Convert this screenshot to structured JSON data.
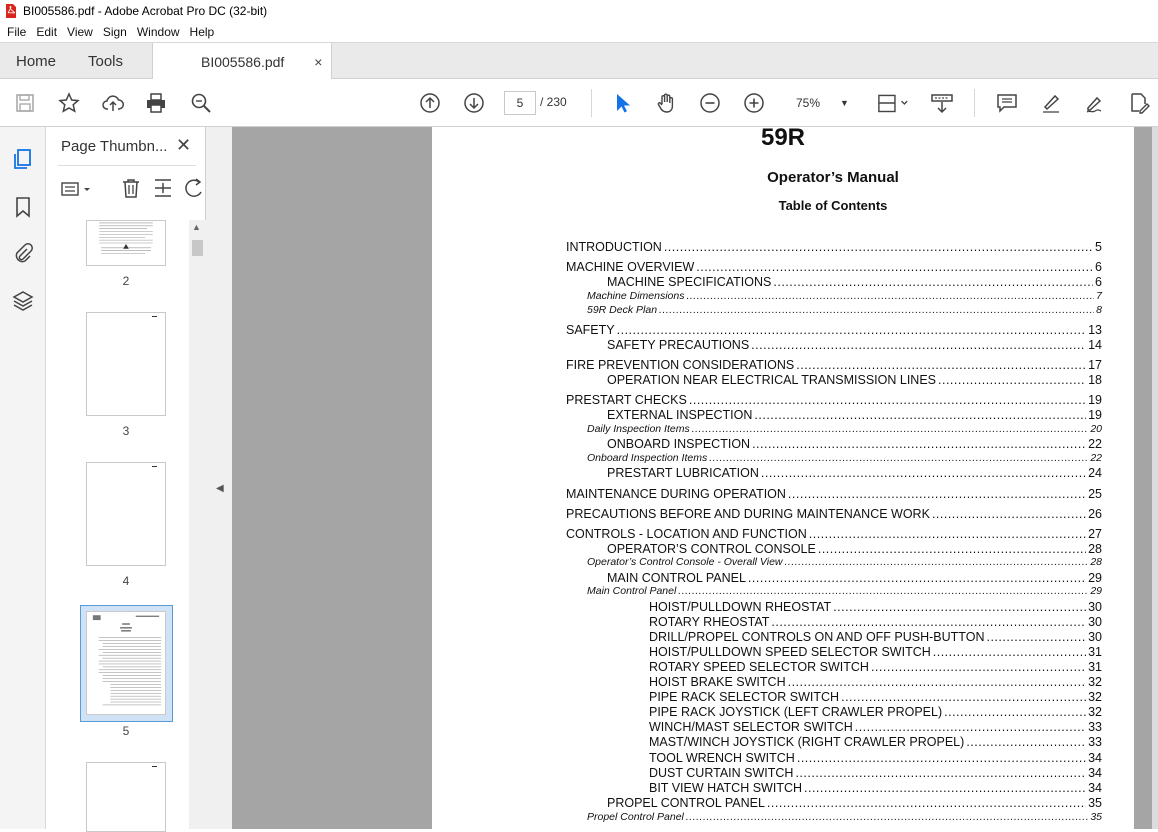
{
  "window": {
    "title": "BI005586.pdf - Adobe Acrobat Pro DC (32-bit)"
  },
  "menu": [
    "File",
    "Edit",
    "View",
    "Sign",
    "Window",
    "Help"
  ],
  "tabs": {
    "home": "Home",
    "tools": "Tools",
    "doc": "BI005586.pdf",
    "close": "×"
  },
  "toolbar": {
    "page_current": "5",
    "page_total": "/ 230",
    "zoom": "75%"
  },
  "thumbnails": {
    "title": "Page Thumbn...",
    "close": "✕",
    "pages": [
      "2",
      "3",
      "4",
      "5"
    ]
  },
  "document": {
    "title": "59R",
    "subtitle": "Operator’s  Manual",
    "toc_heading": "Table of Contents",
    "toc": [
      {
        "text": "INTRODUCTION",
        "page": "5",
        "level": 0
      },
      {
        "text": "MACHINE OVERVIEW",
        "page": "6",
        "level": 0
      },
      {
        "text": "MACHINE SPECIFICATIONS",
        "page": "6",
        "level": 1
      },
      {
        "text": "Machine Dimensions",
        "page": "7",
        "level": 9
      },
      {
        "text": "59R Deck Plan",
        "page": "8",
        "level": 9
      },
      {
        "text": "SAFETY",
        "page": "13",
        "level": 0
      },
      {
        "text": "SAFETY PRECAUTIONS",
        "page": "14",
        "level": 1
      },
      {
        "text": "FIRE PREVENTION CONSIDERATIONS",
        "page": "17",
        "level": 0
      },
      {
        "text": "OPERATION NEAR ELECTRICAL TRANSMISSION LINES",
        "page": "18",
        "level": 1
      },
      {
        "text": "PRESTART  CHECKS",
        "page": "19",
        "level": 0
      },
      {
        "text": "EXTERNAL INSPECTION",
        "page": "19",
        "level": 1
      },
      {
        "text": "Daily Inspection Items",
        "page": "20",
        "level": 9
      },
      {
        "text": "ONBOARD INSPECTION",
        "page": "22",
        "level": 1
      },
      {
        "text": "Onboard Inspection Items",
        "page": "22",
        "level": 9
      },
      {
        "text": "PRESTART LUBRICATION",
        "page": "24",
        "level": 1
      },
      {
        "text": "MAINTENANCE DURING OPERATION",
        "page": "25",
        "level": 0
      },
      {
        "text": "PRECAUTIONS BEFORE AND DURING MAINTENANCE WORK",
        "page": "26",
        "level": 0
      },
      {
        "text": "CONTROLS -  LOCATION AND FUNCTION",
        "page": "27",
        "level": 0
      },
      {
        "text": "OPERATOR’S  CONTROL  CONSOLE",
        "page": "28",
        "level": 1
      },
      {
        "text": "Operator’s Control Console - Overall View",
        "page": "28",
        "level": 9
      },
      {
        "text": "MAIN CONTROL PANEL",
        "page": "29",
        "level": 1
      },
      {
        "text": "Main Control Panel",
        "page": "29",
        "level": 9
      },
      {
        "text": "HOIST/PULLDOWN RHEOSTAT",
        "page": "30",
        "level": 2
      },
      {
        "text": "ROTARY RHEOSTAT",
        "page": "30",
        "level": 2
      },
      {
        "text": "DRILL/PROPEL CONTROLS ON AND OFF PUSH-BUTTON",
        "page": "30",
        "level": 2
      },
      {
        "text": "HOIST/PULLDOWN SPEED SELECTOR SWITCH",
        "page": "31",
        "level": 2
      },
      {
        "text": "ROTARY  SPEED  SELECTOR  SWITCH",
        "page": "31",
        "level": 2
      },
      {
        "text": "HOIST BRAKE SWITCH",
        "page": "32",
        "level": 2
      },
      {
        "text": "PIPE RACK SELECTOR SWITCH",
        "page": "32",
        "level": 2
      },
      {
        "text": "PIPE RACK JOYSTICK (LEFT CRAWLER PROPEL)",
        "page": "32",
        "level": 2
      },
      {
        "text": "WINCH/MAST SELECTOR SWITCH",
        "page": "33",
        "level": 2
      },
      {
        "text": "MAST/WINCH JOYSTICK (RIGHT CRAWLER PROPEL)",
        "page": "33",
        "level": 2
      },
      {
        "text": "TOOL WRENCH SWITCH",
        "page": "34",
        "level": 2
      },
      {
        "text": "DUST CURTAIN SWITCH",
        "page": "34",
        "level": 2
      },
      {
        "text": "BIT VIEW HATCH SWITCH",
        "page": "34",
        "level": 2
      },
      {
        "text": "PROPEL CONTROL PANEL",
        "page": "35",
        "level": 1
      },
      {
        "text": "Propel Control Panel",
        "page": "35",
        "level": 9
      }
    ]
  },
  "colors": {
    "accent": "#1473e6",
    "pdf_red": "#d9261c"
  }
}
